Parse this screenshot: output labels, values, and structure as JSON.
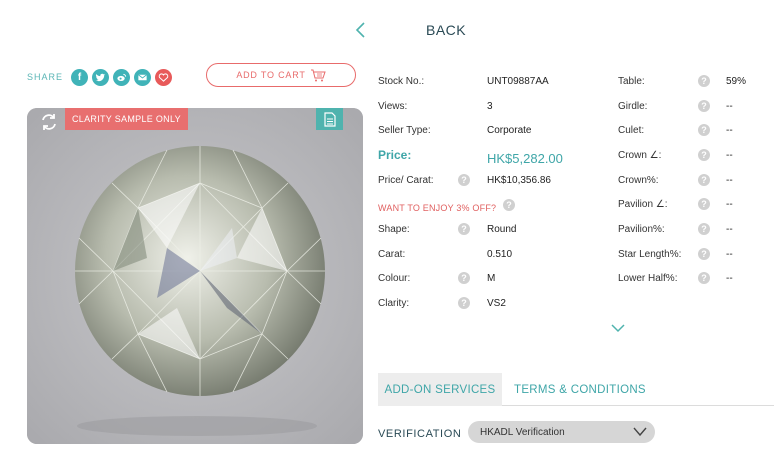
{
  "nav": {
    "back_label": "BACK"
  },
  "share": {
    "label": "SHARE",
    "icons": [
      "facebook-icon",
      "twitter-icon",
      "weibo-icon",
      "email-icon",
      "heart-icon"
    ]
  },
  "cart": {
    "add_label": "ADD TO CART"
  },
  "image": {
    "badge": "CLARITY SAMPLE ONLY"
  },
  "specs_left": [
    {
      "label": "Stock No.:",
      "value": "UNT09887AA"
    },
    {
      "label": "Views:",
      "value": "3"
    },
    {
      "label": "Seller Type:",
      "value": "Corporate"
    },
    {
      "label": "Price:",
      "value": "HK$5,282.00"
    },
    {
      "label": "Price/ Carat:",
      "value": "HK$10,356.86"
    },
    {
      "label": "WANT TO ENJOY 3% OFF?"
    },
    {
      "label": "Shape:",
      "value": "Round"
    },
    {
      "label": "Carat:",
      "value": "0.510"
    },
    {
      "label": "Colour:",
      "value": "M"
    },
    {
      "label": "Clarity:",
      "value": "VS2"
    }
  ],
  "specs_right": [
    {
      "label": "Table:",
      "value": "59%"
    },
    {
      "label": "Girdle:",
      "value": "--"
    },
    {
      "label": "Culet:",
      "value": "--"
    },
    {
      "label": "Crown ∠:",
      "value": "--"
    },
    {
      "label": "Crown%:",
      "value": "--"
    },
    {
      "label": "Pavilion ∠:",
      "value": "--"
    },
    {
      "label": "Pavilion%:",
      "value": "--"
    },
    {
      "label": "Star Length%:",
      "value": "--"
    },
    {
      "label": "Lower Half%:",
      "value": "--"
    }
  ],
  "tabs": [
    {
      "label": "ADD-ON SERVICES",
      "active": true
    },
    {
      "label": "TERMS & CONDITIONS",
      "active": false
    }
  ],
  "verification": {
    "label": "VERIFICATION",
    "selected": "HKADL Verification"
  },
  "colors": {
    "accent": "#3fa6a8",
    "alert": "#e86f6f"
  }
}
